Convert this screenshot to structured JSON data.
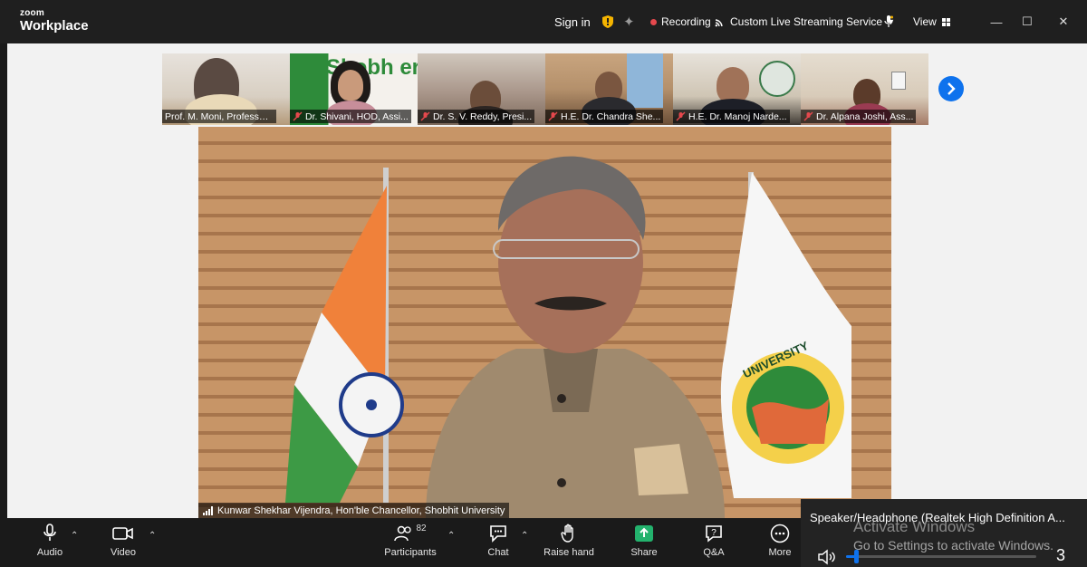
{
  "titlebar": {
    "brand": "zoom",
    "product": "Workplace",
    "sign_in": "Sign in",
    "recording": "Recording",
    "streaming": "Custom Live Streaming Service",
    "view": "View"
  },
  "participants_strip": [
    {
      "name": "Prof. M. Moni, Professor...",
      "muted": false
    },
    {
      "name": "Dr. Shivani, HOD, Assi...",
      "muted": true
    },
    {
      "name": "Dr. S. V. Reddy, Presi...",
      "muted": true
    },
    {
      "name": "H.E. Dr. Chandra She...",
      "muted": true
    },
    {
      "name": "H.E. Dr. Manoj Narde...",
      "muted": true
    },
    {
      "name": "Dr. Alpana Joshi, Ass...",
      "muted": true
    }
  ],
  "tile_background_text": "Shobh ersi",
  "main_speaker": {
    "name": "Kunwar Shekhar Vijendra, Hon'ble Chancellor, Shobhit University",
    "flag_text": "UNIVERSITY"
  },
  "toolbar": {
    "audio": "Audio",
    "video": "Video",
    "participants": "Participants",
    "participants_count": "82",
    "chat": "Chat",
    "raise_hand": "Raise hand",
    "share": "Share",
    "qa": "Q&A",
    "more": "More"
  },
  "audio_popup": {
    "device": "Speaker/Headphone (Realtek High Definition A...",
    "volume_fraction": 0.05,
    "number": "3"
  },
  "watermark": {
    "title": "Activate Windows",
    "subtitle": "Go to Settings to activate Windows."
  },
  "colors": {
    "accent": "#0e72ed",
    "recording": "#e5484d",
    "share": "#23b26d",
    "muted": "#e5484d"
  }
}
